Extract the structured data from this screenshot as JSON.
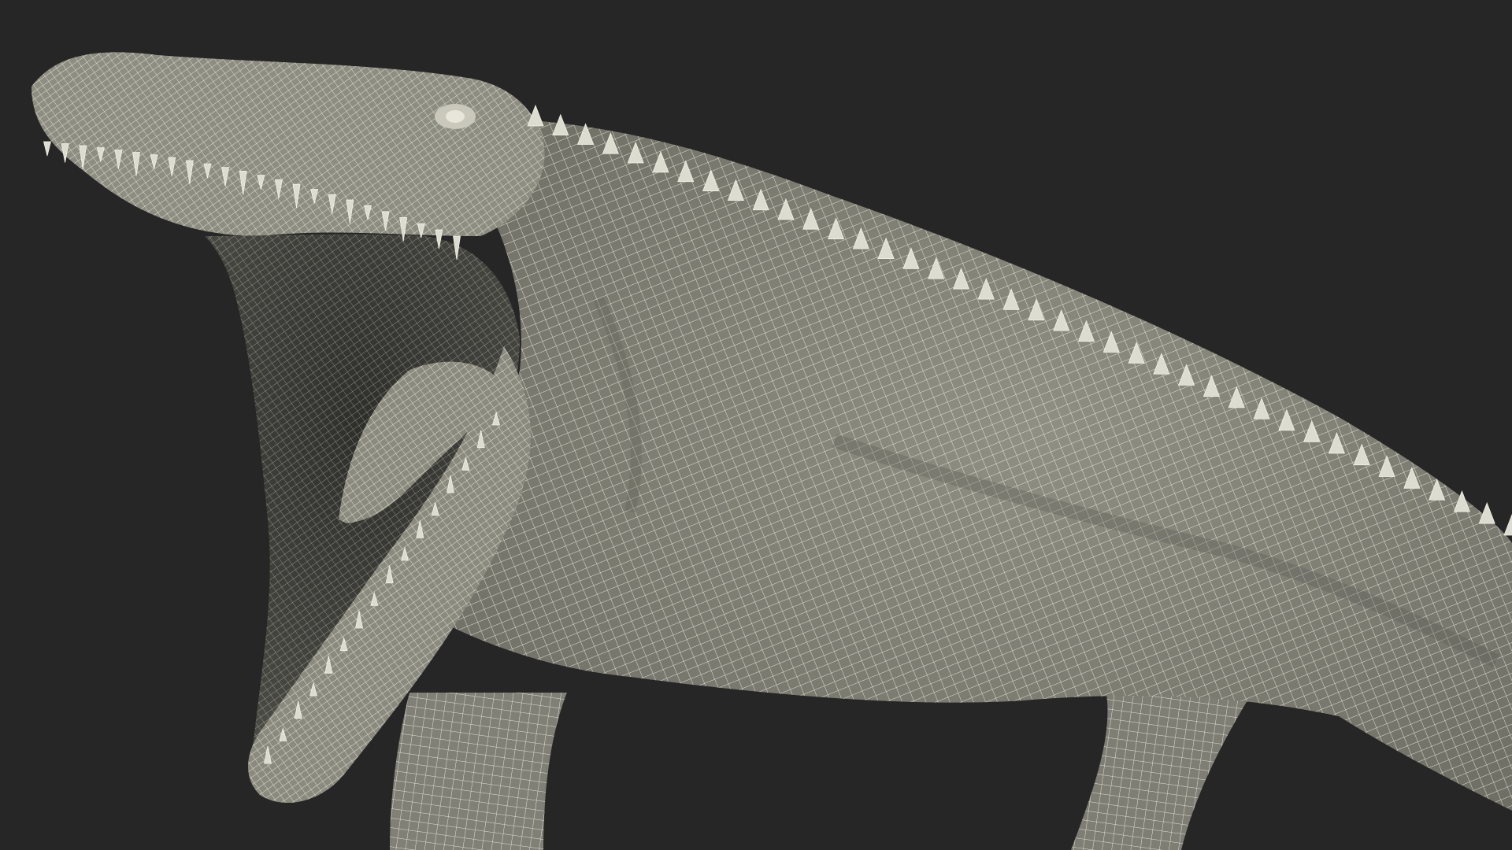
{
  "scene": {
    "subject": "wireframe-reptile-model",
    "colors": {
      "background": "#262626",
      "body_fill": "#8c8c80",
      "body_shadow": "#5f5f57",
      "mouth_inner": "#3a3a36",
      "wire": "#f4f2e6",
      "tooth": "#dcdcd0"
    }
  }
}
